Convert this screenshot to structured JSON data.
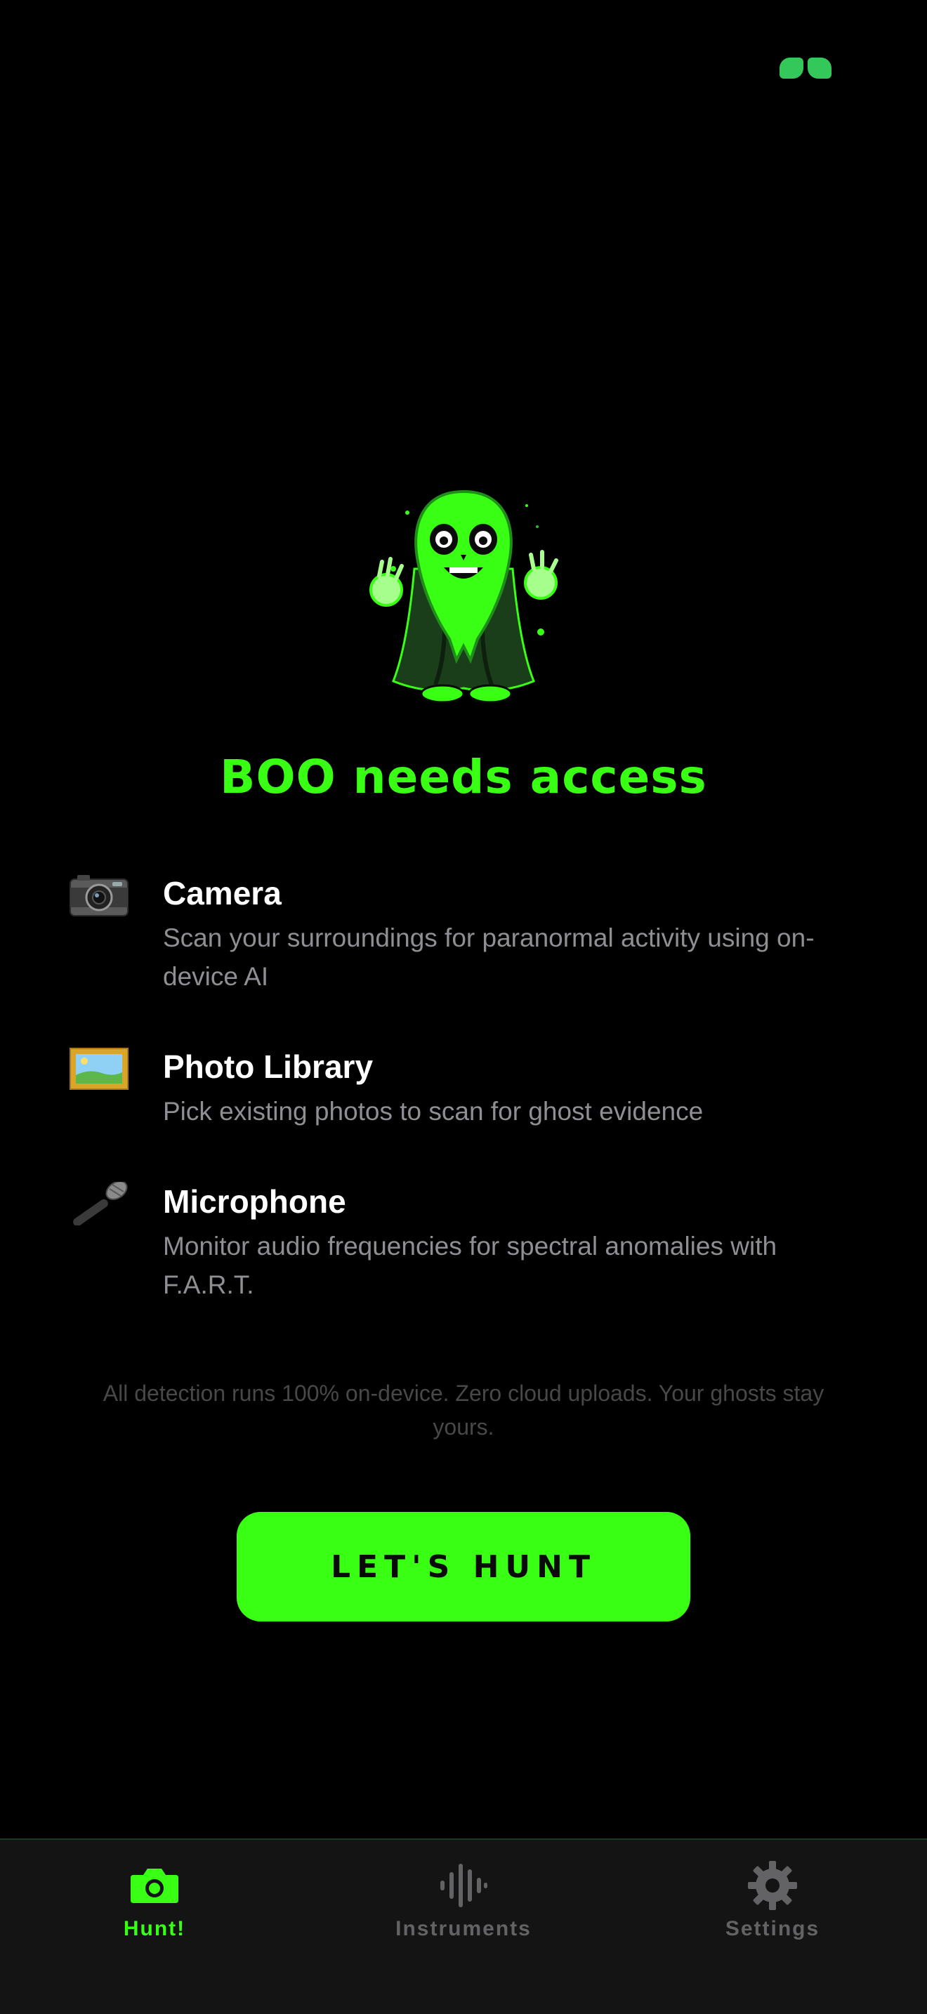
{
  "status": {
    "indicator_icon": "bracket-pair-icon",
    "indicator_color": "#34c759"
  },
  "hero": {
    "mascot_icon": "ghost-mascot-icon"
  },
  "title": "BOO needs access",
  "permissions": [
    {
      "icon": "camera-icon",
      "title": "Camera",
      "description": "Scan your surroundings for paranormal activity using on-device AI"
    },
    {
      "icon": "framed-picture-icon",
      "title": "Photo Library",
      "description": "Pick existing photos to scan for ghost evidence"
    },
    {
      "icon": "microphone-icon",
      "title": "Microphone",
      "description": "Monitor audio frequencies for spectral anomalies with F.A.R.T."
    }
  ],
  "privacy_note": "All detection runs 100% on-device. Zero cloud uploads. Your ghosts stay yours.",
  "cta_label": "LET'S HUNT",
  "tabs": [
    {
      "icon": "camera-icon",
      "label": "Hunt!",
      "active": true
    },
    {
      "icon": "waveform-icon",
      "label": "Instruments",
      "active": false
    },
    {
      "icon": "gear-icon",
      "label": "Settings",
      "active": false
    }
  ],
  "colors": {
    "accent": "#39ff14",
    "background": "#000000",
    "tabbar": "#141414",
    "secondary_text": "#8e8e93",
    "inactive_tab": "#636366"
  }
}
